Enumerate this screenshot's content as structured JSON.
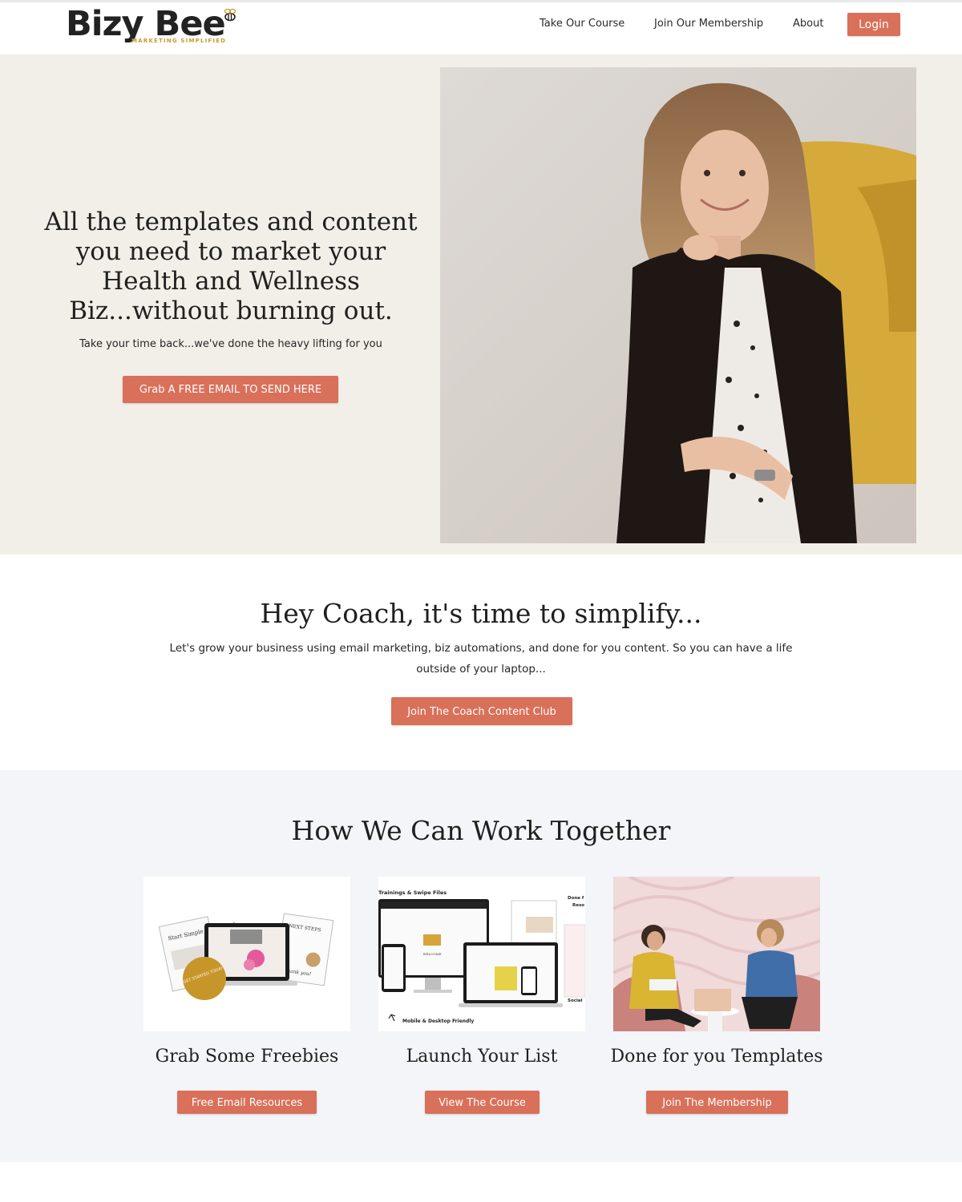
{
  "brand": {
    "name": "Bizy Bee",
    "tagline": "MARKETING SIMPLIFIED",
    "accent_color": "#d9705a",
    "hero_bg": "#f1efe8",
    "section_bg": "#f3f5f8"
  },
  "nav": {
    "items": [
      {
        "label": "Take Our Course"
      },
      {
        "label": "Join Our Membership"
      },
      {
        "label": "About"
      }
    ],
    "login_label": "Login"
  },
  "hero": {
    "title_lines": [
      "All the templates and content",
      "you need to market your",
      "Health and Wellness",
      "Biz...without burning out."
    ],
    "subtitle": "Take your time back...we've done the heavy lifting for you",
    "button_label": "Grab A FREE EMAIL TO SEND HERE",
    "image_icon": "woman-portrait-photo"
  },
  "coach": {
    "title": "Hey Coach, it's time to simplify...",
    "body_lines": [
      "Let's grow your business using email marketing, biz automations, and done for you content.  So you can have a life",
      "outside of your laptop..."
    ],
    "button_label": "Join The Coach Content Club"
  },
  "work": {
    "title": "How We Can Work Together",
    "cards": [
      {
        "title": "Grab Some Freebies",
        "button_label": "Free Email Resources",
        "image_texts": {
          "sheet_left": "Start Simple Framework",
          "sheet_right": "NEXT STEPS",
          "thanks": "Thank you!",
          "badge": "GET STARTED TODAY"
        }
      },
      {
        "title": "Launch Your List",
        "button_label": "View The Course",
        "image_texts": {
          "header": "Trainings & Swipe Files",
          "done": "Done f",
          "resources": "Reso",
          "social": "Social",
          "mobile": "Mobile & Desktop Friendly",
          "welcome": "WELCOME"
        }
      },
      {
        "title": "Done for you Templates",
        "button_label": "Join The Membership",
        "image_icon": "two-women-laptop-photo"
      }
    ]
  }
}
